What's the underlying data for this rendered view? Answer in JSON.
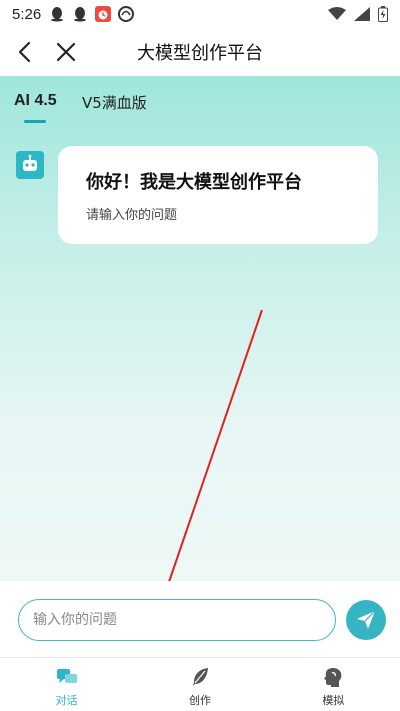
{
  "status": {
    "time": "5:26",
    "left_icons": [
      "qq-icon",
      "qq-icon",
      "alarm-app-icon",
      "browser-icon"
    ],
    "right_icons": [
      "wifi-icon",
      "signal-icon",
      "battery-icon"
    ]
  },
  "titlebar": {
    "title": "大模型创作平台"
  },
  "tabs": [
    {
      "label": "AI 4.5",
      "active": true
    },
    {
      "label": "V5满血版",
      "active": false
    }
  ],
  "chat": {
    "greeting": "你好！我是大模型创作平台",
    "prompt": "请输入你的问题"
  },
  "input": {
    "placeholder": "输入你的问题",
    "value": ""
  },
  "nav": [
    {
      "label": "对话",
      "icon": "chat-icon",
      "active": true
    },
    {
      "label": "创作",
      "icon": "feather-icon",
      "active": false
    },
    {
      "label": "模拟",
      "icon": "head-profile-icon",
      "active": false
    }
  ],
  "colors": {
    "accent": "#2bb7c4",
    "annotation_arrow": "#e02020"
  }
}
